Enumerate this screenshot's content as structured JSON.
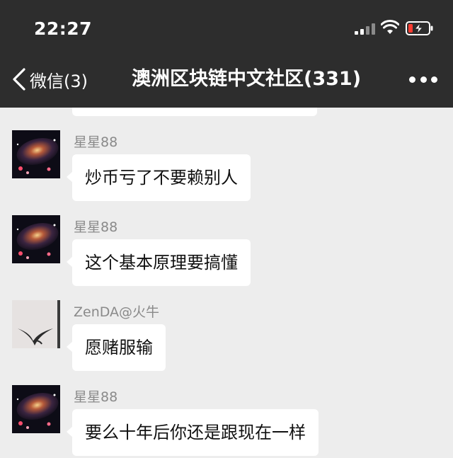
{
  "status_bar": {
    "time": "22:27"
  },
  "nav": {
    "back_label": "微信(3)",
    "title": "澳洲区块链中文社区(331)"
  },
  "messages": [
    {
      "sender": "星星88",
      "text": "炒币亏了不要赖别人",
      "avatar": "galaxy-avatar"
    },
    {
      "sender": "星星88",
      "text": "这个基本原理要搞懂",
      "avatar": "galaxy-avatar"
    },
    {
      "sender": "ZenDA@火牛",
      "text": "愿赌服输",
      "avatar": "ink-figure-avatar"
    },
    {
      "sender": "星星88",
      "text": "要么十年后你还是跟现在一样",
      "avatar": "galaxy-avatar"
    }
  ],
  "colors": {
    "header_bg": "#2d2d2d",
    "chat_bg": "#ededed",
    "bubble_bg": "#ffffff",
    "battery_low": "#ff3b30"
  }
}
